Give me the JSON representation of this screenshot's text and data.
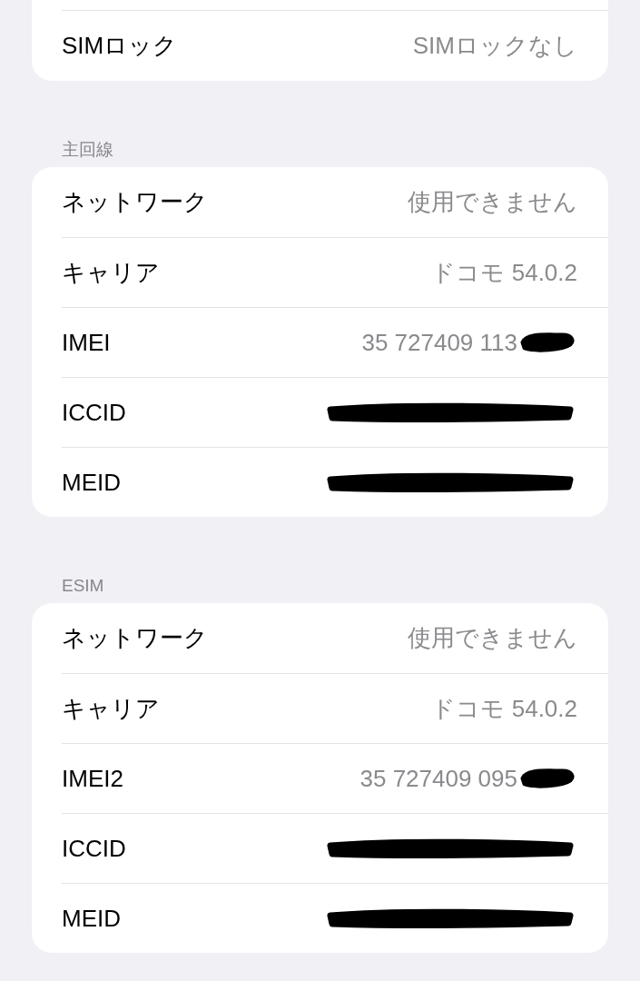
{
  "top_group": {
    "rows": [
      {
        "label": "SIMロック",
        "value": "SIMロックなし"
      }
    ]
  },
  "sections": [
    {
      "header": "主回線",
      "rows": [
        {
          "label": "ネットワーク",
          "value": "使用できません"
        },
        {
          "label": "キャリア",
          "value": "ドコモ 54.0.2"
        },
        {
          "label": "IMEI",
          "value": "35 727409 113",
          "redacted": true
        },
        {
          "label": "ICCID",
          "redacted": true
        },
        {
          "label": "MEID",
          "redacted": true
        }
      ]
    },
    {
      "header": "ESIM",
      "rows": [
        {
          "label": "ネットワーク",
          "value": "使用できません"
        },
        {
          "label": "キャリア",
          "value": "ドコモ 54.0.2"
        },
        {
          "label": "IMEI2",
          "value": "35 727409 095",
          "redacted": true
        },
        {
          "label": "ICCID",
          "redacted": true
        },
        {
          "label": "MEID",
          "redacted": true
        }
      ]
    }
  ]
}
